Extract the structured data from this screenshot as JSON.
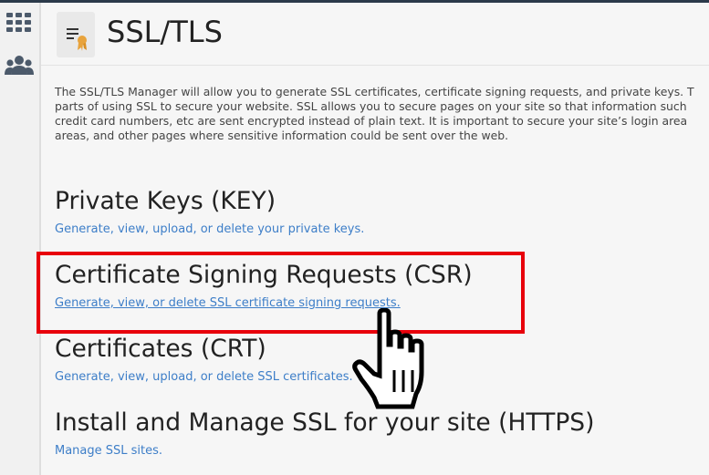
{
  "sidebar": {
    "items": [
      {
        "icon": "grid-icon",
        "color": "#4c5a6b"
      },
      {
        "icon": "users-icon",
        "color": "#4c5a6b"
      }
    ]
  },
  "page": {
    "title": "SSL/TLS",
    "icon": "certificate-document-icon",
    "intro_lines": [
      "The SSL/TLS Manager will allow you to generate SSL certificates, certificate signing requests, and private keys. T",
      "parts of using SSL to secure your website. SSL allows you to secure pages on your site so that information such",
      "credit card numbers, etc are sent encrypted instead of plain text. It is important to secure your site’s login area",
      "areas, and other pages where sensitive information could be sent over the web."
    ]
  },
  "sections": [
    {
      "title": "Private Keys (KEY)",
      "link": "Generate, view, upload, or delete your private keys."
    },
    {
      "title": "Certificate Signing Requests (CSR)",
      "link": "Generate, view, or delete SSL certificate signing requests."
    },
    {
      "title": "Certificates (CRT)",
      "link": "Generate, view, upload, or delete SSL certificates."
    },
    {
      "title": "Install and Manage SSL for your site (HTTPS)",
      "link": "Manage SSL sites."
    }
  ],
  "colors": {
    "link": "#3d7ec8",
    "highlight": "#e8000b",
    "accent_ribbon": "#e8a33c"
  }
}
